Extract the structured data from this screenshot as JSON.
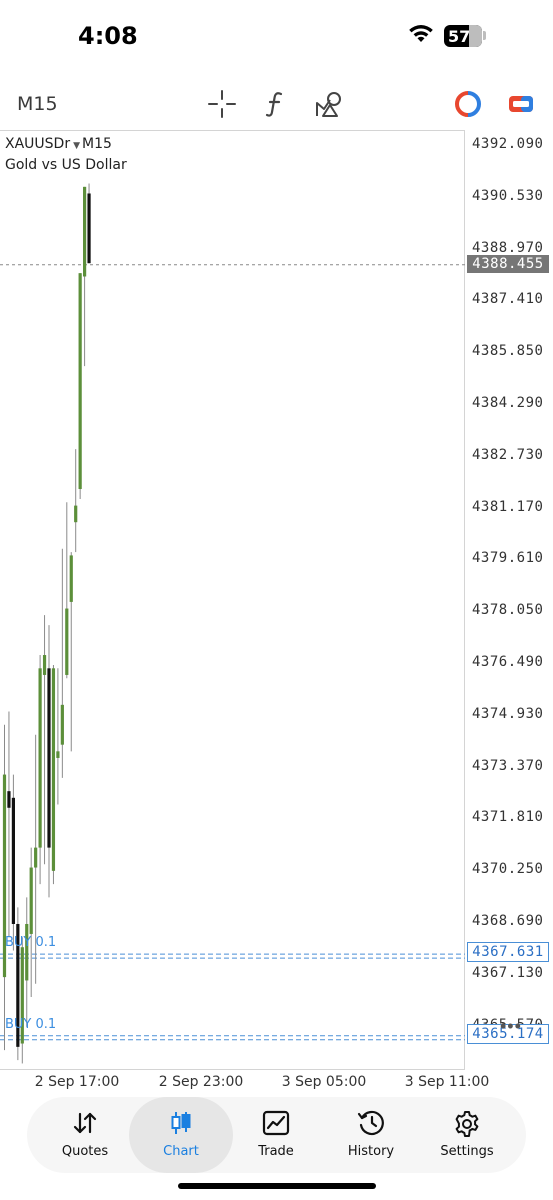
{
  "status_bar": {
    "time": "4:08",
    "battery": "57"
  },
  "toolbar": {
    "timeframe": "M15",
    "icons": [
      "crosshair-icon",
      "indicator-function-icon",
      "objects-icon",
      "one-click-trading-icon",
      "chart-type-icon"
    ]
  },
  "chart": {
    "symbol": "XAUUSDr",
    "timeframe": "M15",
    "description": "Gold vs US Dollar",
    "price_labels": [
      "4392.090",
      "4390.530",
      "4388.970",
      "4387.410",
      "4385.850",
      "4384.290",
      "4382.730",
      "4381.170",
      "4379.610",
      "4378.050",
      "4376.490",
      "4374.930",
      "4373.370",
      "4371.810",
      "4370.250",
      "4368.690",
      "4367.130",
      "4365.570"
    ],
    "current_price": "4388.455",
    "orders": [
      {
        "label": "BUY 0.1",
        "price": "4367.631"
      },
      {
        "label": "BUY 0.1",
        "price": "4365.174"
      }
    ],
    "time_labels": [
      "2 Sep 17:00",
      "2 Sep 23:00",
      "3 Sep 05:00",
      "3 Sep 11:00"
    ],
    "colors": {
      "bull": "#5c8f3a",
      "bear": "#111111",
      "order_line": "#4a8fd6",
      "current_line": "#888888"
    }
  },
  "chart_data": {
    "type": "candlestick",
    "ylim": [
      4364.6,
      4392.9
    ],
    "candles": [
      {
        "o": 4367.0,
        "h": 4374.6,
        "l": 4364.8,
        "c": 4373.1
      },
      {
        "o": 4372.6,
        "h": 4375.0,
        "l": 4368.2,
        "c": 4372.1
      },
      {
        "o": 4372.4,
        "h": 4373.1,
        "l": 4367.8,
        "c": 4368.6
      },
      {
        "o": 4368.6,
        "h": 4369.1,
        "l": 4364.5,
        "c": 4364.9
      },
      {
        "o": 4365.0,
        "h": 4368.2,
        "l": 4364.4,
        "c": 4367.9
      },
      {
        "o": 4366.9,
        "h": 4369.4,
        "l": 4365.5,
        "c": 4368.6
      },
      {
        "o": 4368.3,
        "h": 4370.9,
        "l": 4366.4,
        "c": 4370.3
      },
      {
        "o": 4370.3,
        "h": 4374.3,
        "l": 4366.8,
        "c": 4370.9
      },
      {
        "o": 4370.9,
        "h": 4376.7,
        "l": 4369.8,
        "c": 4376.3
      },
      {
        "o": 4376.1,
        "h": 4377.9,
        "l": 4370.4,
        "c": 4376.7
      },
      {
        "o": 4376.3,
        "h": 4377.6,
        "l": 4369.4,
        "c": 4370.9
      },
      {
        "o": 4370.2,
        "h": 4376.4,
        "l": 4369.8,
        "c": 4376.3
      },
      {
        "o": 4373.6,
        "h": 4376.3,
        "l": 4372.2,
        "c": 4373.8
      },
      {
        "o": 4374.0,
        "h": 4379.9,
        "l": 4373.0,
        "c": 4375.2
      },
      {
        "o": 4376.1,
        "h": 4381.3,
        "l": 4376.0,
        "c": 4378.1
      },
      {
        "o": 4378.3,
        "h": 4379.8,
        "l": 4373.8,
        "c": 4379.7
      },
      {
        "o": 4380.7,
        "h": 4382.9,
        "l": 4379.8,
        "c": 4381.2
      },
      {
        "o": 4381.7,
        "h": 4388.2,
        "l": 4381.4,
        "c": 4388.2
      },
      {
        "o": 4388.1,
        "h": 4390.8,
        "l": 4385.4,
        "c": 4390.8
      },
      {
        "o": 4390.6,
        "h": 4390.9,
        "l": 4388.5,
        "c": 4388.5
      }
    ]
  },
  "nav": [
    {
      "label": "Quotes",
      "icon": "quotes-arrows-icon",
      "active": false
    },
    {
      "label": "Chart",
      "icon": "candlestick-icon",
      "active": true
    },
    {
      "label": "Trade",
      "icon": "trade-chart-icon",
      "active": false
    },
    {
      "label": "History",
      "icon": "history-clock-icon",
      "active": false
    },
    {
      "label": "Settings",
      "icon": "gear-icon",
      "active": false
    }
  ]
}
